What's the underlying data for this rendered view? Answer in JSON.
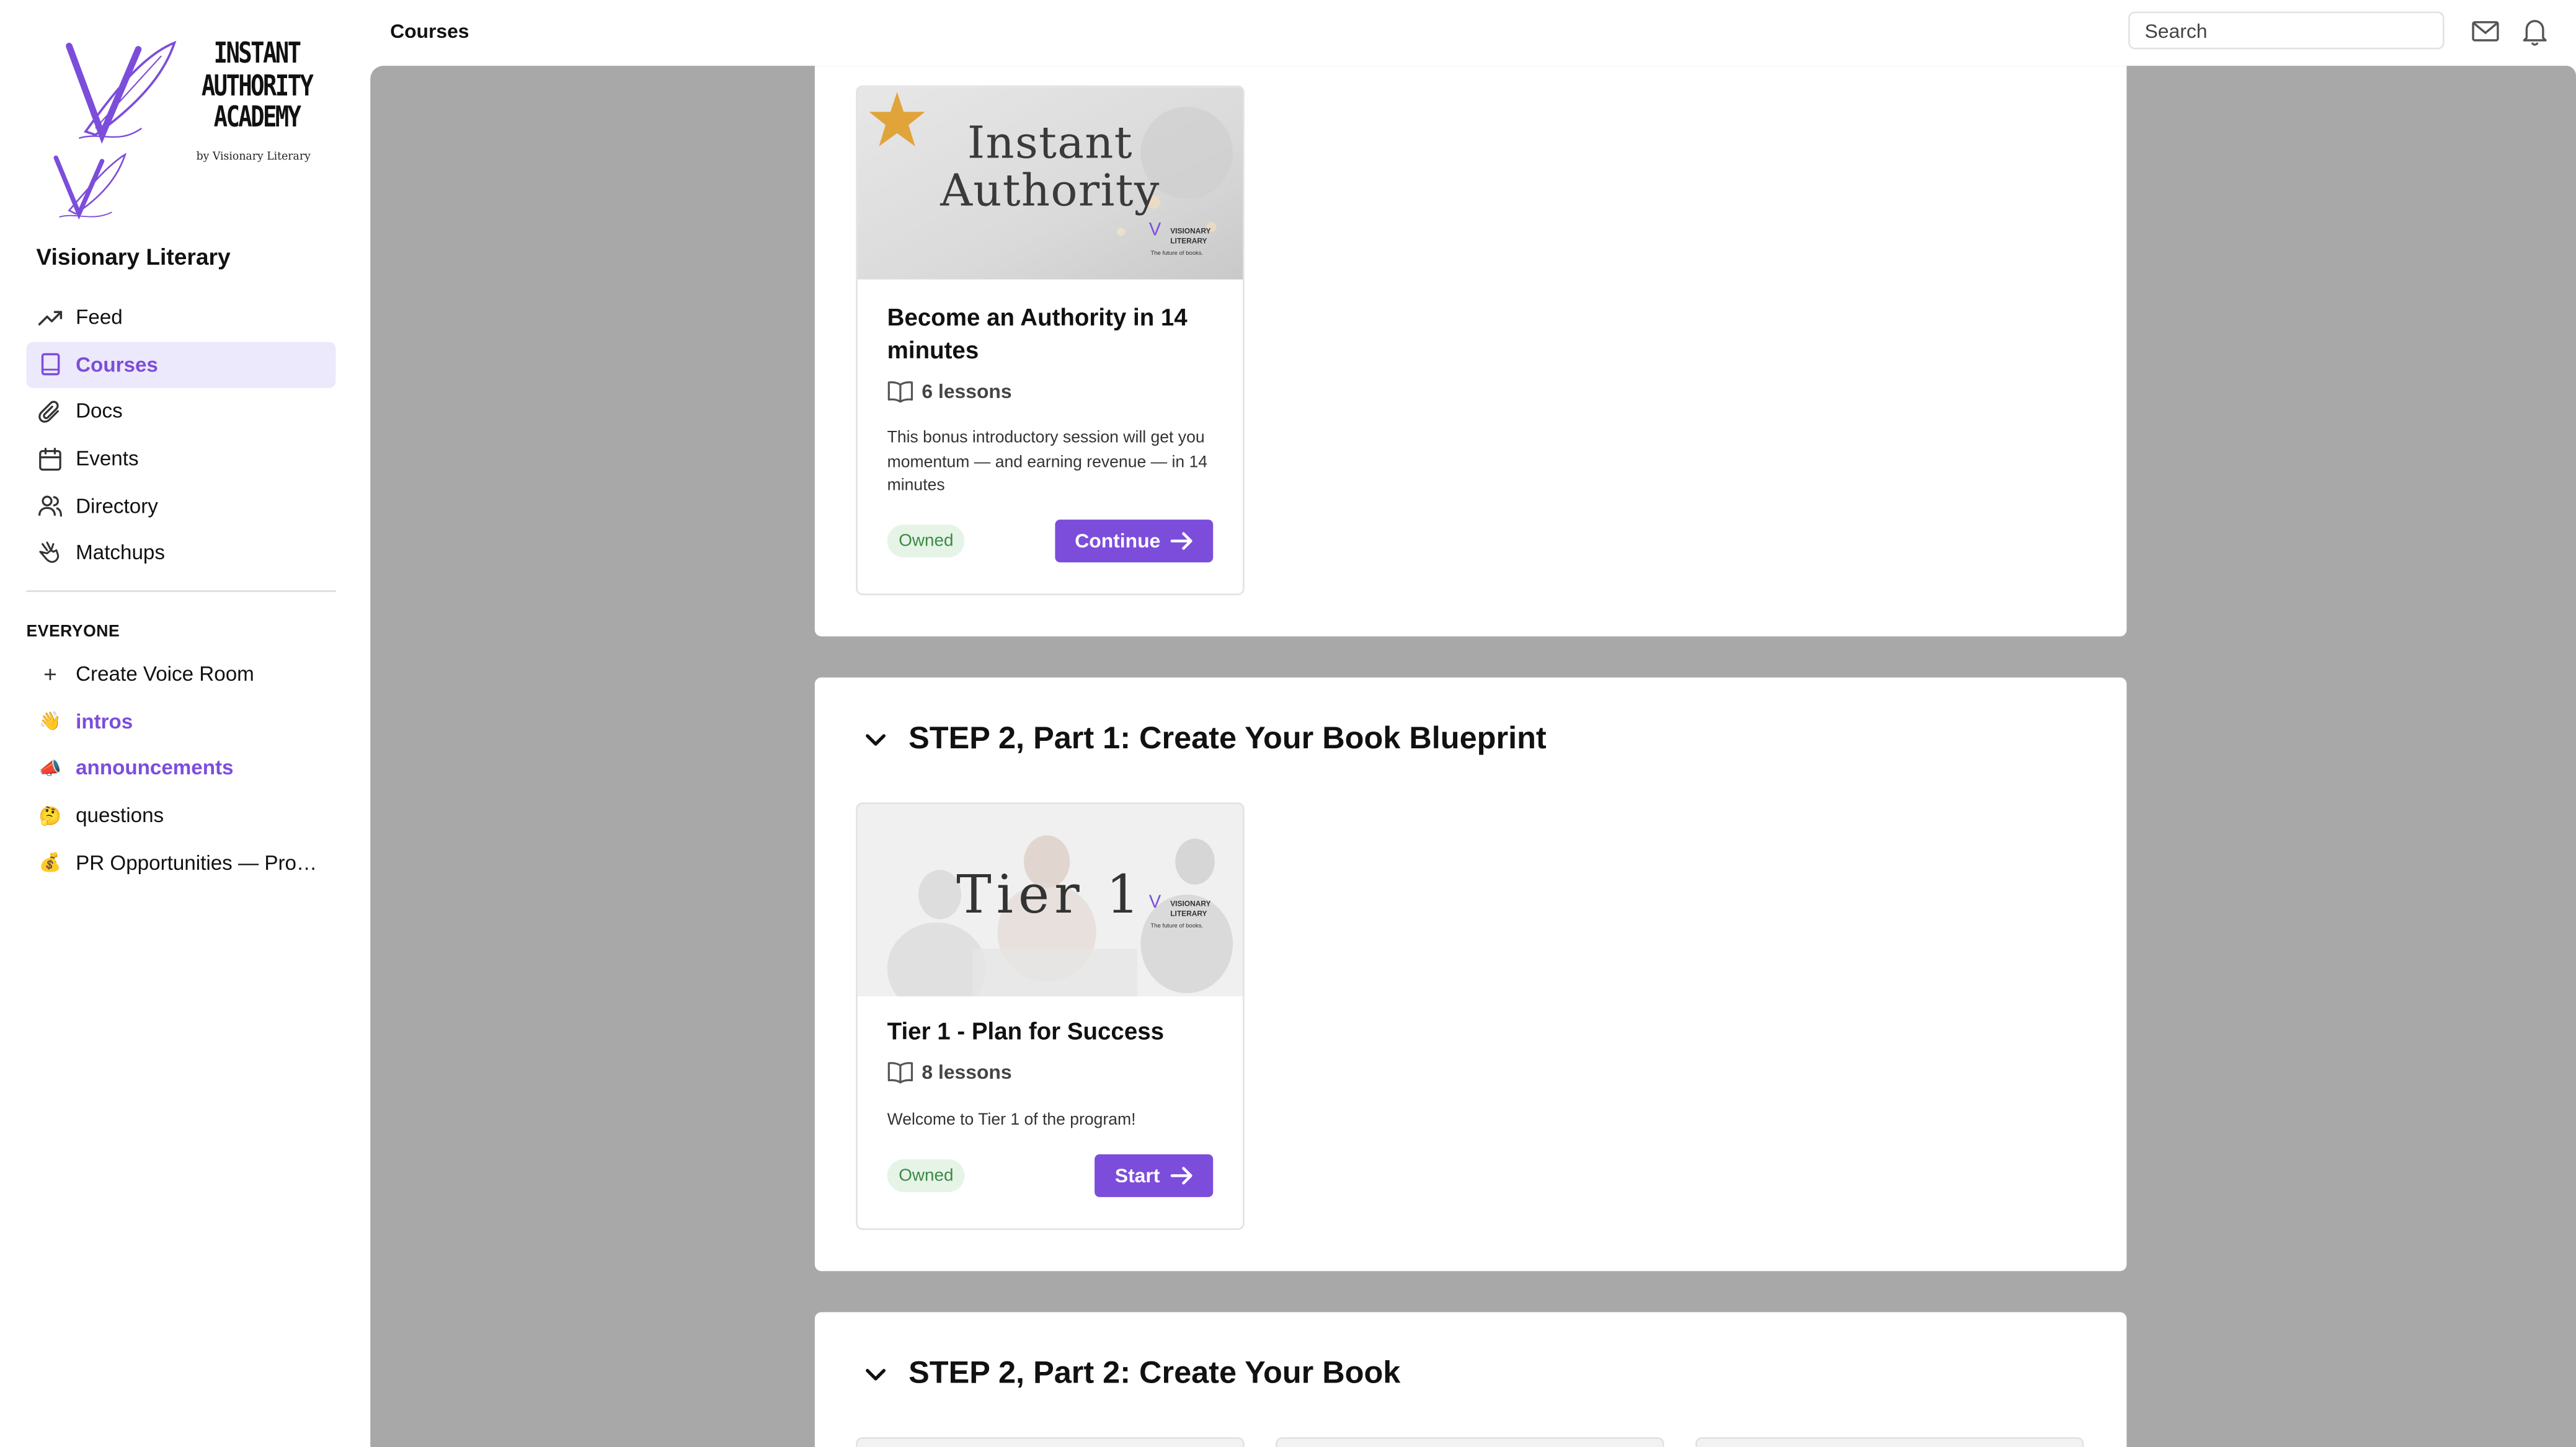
{
  "sidebar": {
    "logo": {
      "line1": "INSTANT",
      "line2": "AUTHORITY",
      "line3": "ACADEMY",
      "byline": "by Visionary Literary",
      "icon": "quill-v-logo-icon"
    },
    "community_name": "Visionary Literary",
    "nav": [
      {
        "label": "Feed",
        "icon": "trending-up-icon",
        "active": false
      },
      {
        "label": "Courses",
        "icon": "book-icon",
        "active": true
      },
      {
        "label": "Docs",
        "icon": "paperclip-icon",
        "active": false
      },
      {
        "label": "Events",
        "icon": "calendar-icon",
        "active": false
      },
      {
        "label": "Directory",
        "icon": "users-icon",
        "active": false
      },
      {
        "label": "Matchups",
        "icon": "handshake-icon",
        "active": false
      }
    ],
    "section_label": "EVERYONE",
    "channels": [
      {
        "label": "Create Voice Room",
        "icon": "plus-icon",
        "emoji": "+",
        "bold": false
      },
      {
        "label": "intros",
        "icon": "waving-hand-icon",
        "emoji": "👋",
        "bold": true
      },
      {
        "label": "announcements",
        "icon": "megaphone-icon",
        "emoji": "📣",
        "bold": true
      },
      {
        "label": "questions",
        "icon": "thinking-face-icon",
        "emoji": "🤔",
        "bold": false
      },
      {
        "label": "PR Opportunities — Pro_El...",
        "icon": "money-bag-icon",
        "emoji": "💰",
        "bold": false
      }
    ]
  },
  "topbar": {
    "title": "Courses",
    "search_placeholder": "Search",
    "icons": [
      "mail-icon",
      "bell-icon"
    ]
  },
  "colors": {
    "accent": "#7c4ddb",
    "accent_bg": "#ede9fc",
    "main_bg": "#a8a8a8",
    "owned_bg": "#e6f4e7",
    "owned_text": "#3c8a45"
  },
  "main": {
    "sections": [
      {
        "title": "",
        "courses": [
          {
            "image_title_line1": "Instant",
            "image_title_line2": "Authority",
            "image_brand_line1": "VISIONARY",
            "image_brand_line2": "LITERARY",
            "image_brand_tagline": "The future of books.",
            "title": "Become an Authority in 14 minutes",
            "lessons": "6 lessons",
            "description": "This bonus introductory session will get you momentum — and earning revenue — in 14 minutes",
            "badge": "Owned",
            "button": "Continue"
          }
        ]
      },
      {
        "title": "STEP 2, Part 1: Create Your Book Blueprint",
        "courses": [
          {
            "image_title": "Tier 1",
            "image_brand_line1": "VISIONARY",
            "image_brand_line2": "LITERARY",
            "image_brand_tagline": "The future of books.",
            "title": "Tier 1 - Plan for Success",
            "lessons": "8 lessons",
            "description": "Welcome to Tier 1 of the program!",
            "badge": "Owned",
            "button": "Start"
          }
        ]
      },
      {
        "title": "STEP 2, Part 2: Create Your Book",
        "courses": []
      }
    ]
  }
}
